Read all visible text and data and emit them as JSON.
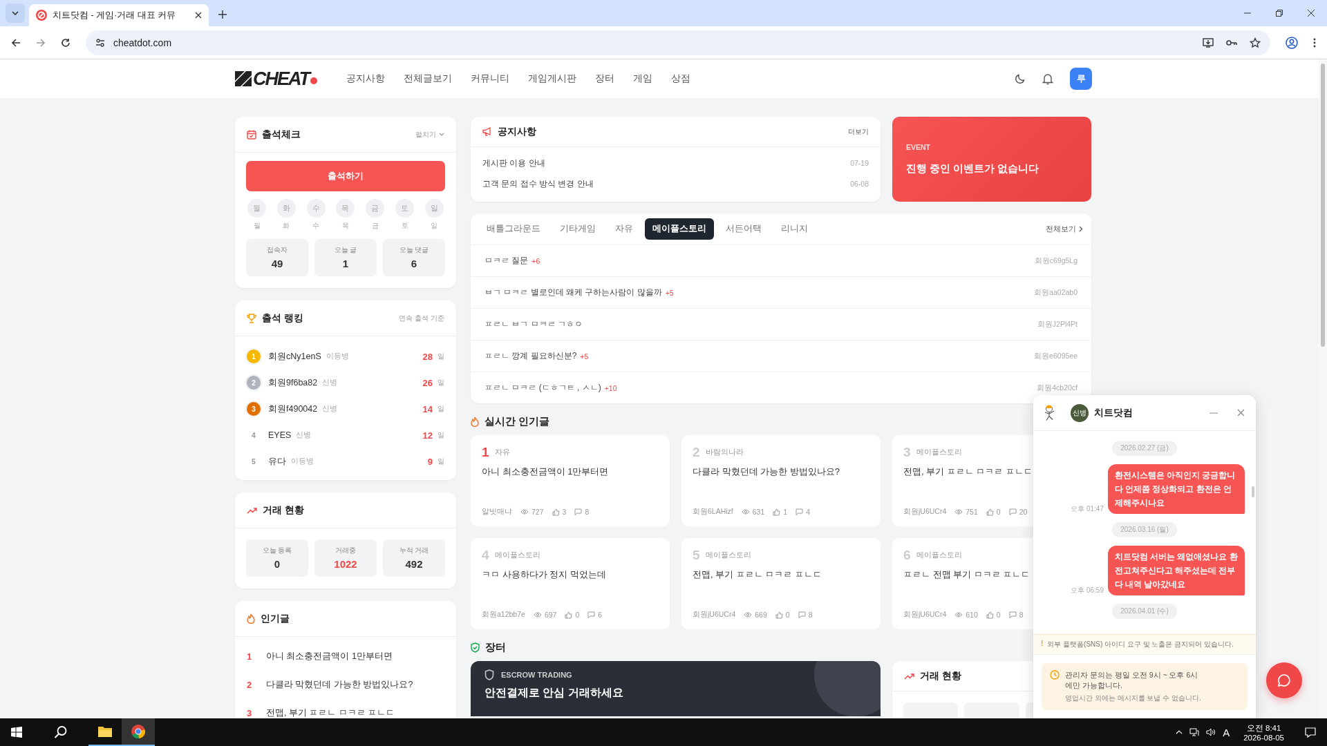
{
  "browser": {
    "tab_title": "치트닷컴 - 게임·거래 대표 커뮤",
    "url": "cheatdot.com"
  },
  "header": {
    "logo": "CHEAT",
    "nav": [
      "공지사항",
      "전체글보기",
      "커뮤니티",
      "게임게시판",
      "장터",
      "게임",
      "상점"
    ],
    "avatar": "루"
  },
  "attendance": {
    "title": "출석체크",
    "toggle": "펼치기",
    "button": "출석하기",
    "days": [
      {
        "circle": "월",
        "label": "월",
        "checked": false
      },
      {
        "circle": "화",
        "label": "화",
        "checked": false
      },
      {
        "circle": "수",
        "label": "수",
        "checked": false
      },
      {
        "circle": "목",
        "label": "목",
        "checked": false
      },
      {
        "circle": "금",
        "label": "금",
        "checked": false
      },
      {
        "circle": "토",
        "label": "토",
        "checked": false
      },
      {
        "circle": "일",
        "label": "일",
        "checked": false
      }
    ],
    "stats": [
      {
        "label": "접속자",
        "value": "49"
      },
      {
        "label": "오늘 글",
        "value": "1"
      },
      {
        "label": "오늘 댓글",
        "value": "6"
      }
    ]
  },
  "ranking": {
    "title": "출석 랭킹",
    "note": "연속 출석 기준",
    "items": [
      {
        "kind": "medal",
        "color": "#f5b800",
        "rank": "1",
        "name": "회원cNy1enS",
        "grade": "이등병",
        "days": "28",
        "unit": "일"
      },
      {
        "kind": "medal",
        "color": "#aeb4bd",
        "rank": "2",
        "name": "회원9f6ba82",
        "grade": "신병",
        "days": "26",
        "unit": "일"
      },
      {
        "kind": "medal",
        "color": "#e07000",
        "rank": "3",
        "name": "회원f490042",
        "grade": "신병",
        "days": "14",
        "unit": "일"
      },
      {
        "kind": "plain",
        "rank": "4",
        "name": "EYES",
        "grade": "신병",
        "days": "12",
        "unit": "일"
      },
      {
        "kind": "plain",
        "rank": "5",
        "name": "유다",
        "grade": "이등병",
        "days": "9",
        "unit": "일"
      }
    ]
  },
  "trade": {
    "title": "거래 현황",
    "stats": [
      {
        "label": "오늘 등록",
        "value": "0",
        "highlight": false
      },
      {
        "label": "거래중",
        "value": "1022",
        "highlight": true
      },
      {
        "label": "누적 거래",
        "value": "492",
        "highlight": false
      }
    ]
  },
  "popular": {
    "title": "인기글",
    "items": [
      {
        "rank": "1",
        "title": "아니 최소충전금액이 1만부터면"
      },
      {
        "rank": "2",
        "title": "다클라 막혔던데 가능한 방법있나요?"
      },
      {
        "rank": "3",
        "title": "전맵, 부기 ㅍㄹㄴ ㅁㅋㄹ ㅍㄴㄷ"
      }
    ]
  },
  "notice": {
    "title": "공지사항",
    "more": "더보기",
    "items": [
      {
        "title": "게시판 이용 안내",
        "date": "07-19"
      },
      {
        "title": "고객 문의 접수 방식 변경 안내",
        "date": "06-08"
      }
    ]
  },
  "event": {
    "label": "EVENT",
    "text": "진행 중인 이벤트가 없습니다"
  },
  "board": {
    "tabs": [
      {
        "label": "배틀그라운드",
        "selected": false
      },
      {
        "label": "기타게임",
        "selected": false
      },
      {
        "label": "자유",
        "selected": false
      },
      {
        "label": "메이플스토리",
        "selected": true
      },
      {
        "label": "서든어택",
        "selected": false
      },
      {
        "label": "리니지",
        "selected": false
      }
    ],
    "more": "전체보기",
    "posts": [
      {
        "title": "ㅁㅋㄹ 질문",
        "comments": "+6",
        "author": "회원c69g5Lg"
      },
      {
        "title": "ㅂㄱ ㅁㅋㄹ 별로인데 왜케 구하는사람이 많을까",
        "comments": "+5",
        "author": "회원aa02ab0"
      },
      {
        "title": "ㅍㄹㄴ ㅂㄱ ㅁㅋㄹ ㄱㅎㅇ",
        "author": "회원J2Pl4Pt"
      },
      {
        "title": "ㅍㄹㄴ 깡계 필요하신분?",
        "comments": "+5",
        "author": "회원e6095ee"
      },
      {
        "title": "ㅍㄹㄴ ㅁㅋㄹ (ㄷㅎㄱㅌ , ㅅㄴ)",
        "comments": "+10",
        "author": "회원4cb20cf"
      }
    ]
  },
  "realtime": {
    "title": "실시간 인기글",
    "cards": [
      {
        "rank": "1",
        "hot": true,
        "board": "자유",
        "title": "아니 최소충전금액이 1만부터면",
        "author": "알빗매냐",
        "views": "727",
        "likes": "3",
        "comments": "8"
      },
      {
        "rank": "2",
        "hot": false,
        "board": "바람의나라",
        "title": "다클라 막혔던데 가능한 방법있나요?",
        "author": "회원6LAHizf",
        "views": "631",
        "likes": "1",
        "comments": "4"
      },
      {
        "rank": "3",
        "hot": false,
        "board": "메이플스토리",
        "title": "전맵, 부기 ㅍㄹㄴ ㅁㅋㄹ ㅍㄴㄷ",
        "author": "회원jU6UCr4",
        "views": "751",
        "likes": "0",
        "comments": "20"
      },
      {
        "rank": "4",
        "hot": false,
        "board": "메이플스토리",
        "title": "ㅋㅁ 사용하다가 정지 먹었는데",
        "author": "회원a12bb7e",
        "views": "697",
        "likes": "0",
        "comments": "6"
      },
      {
        "rank": "5",
        "hot": false,
        "board": "메이플스토리",
        "title": "전맵, 부기 ㅍㄹㄴ ㅁㅋㄹ ㅍㄴㄷ",
        "author": "회원jU6UCr4",
        "views": "669",
        "likes": "0",
        "comments": "8"
      },
      {
        "rank": "6",
        "hot": false,
        "board": "메이플스토리",
        "title": "ㅍㄹㄴ 전맵 부기 ㅁㅋㄹ ㅍㄴㄷ",
        "author": "회원jU6UCr4",
        "views": "610",
        "likes": "0",
        "comments": "8"
      }
    ]
  },
  "market": {
    "title": "장터",
    "escrow_label": "ESCROW TRADING",
    "escrow_headline": "안전결제로 안심 거래하세요",
    "trade_title": "거래 현황"
  },
  "chat": {
    "title": "치트닷컴",
    "badge": "신병",
    "messages": [
      {
        "kind": "date",
        "text": "2026.02.27 (금)"
      },
      {
        "kind": "out",
        "text": "환전시스템은 아직인지 궁금합니다 언제쯤 정상화되고 환전은 언제해주시나요",
        "time": "오후 01:47"
      },
      {
        "kind": "date",
        "text": "2026.03.16 (월)"
      },
      {
        "kind": "out",
        "text": "치트닷컴 서버는 왜없애셨나요 환전고쳐주신다고 해주셨는데 전부다 내역 날아갔네요",
        "time": "오후 06:59"
      },
      {
        "kind": "date",
        "text": "2026.04.01 (수)"
      }
    ],
    "warning_mark": "!",
    "warning": "외부 플랫폼(SNS) 아이디 요구 및 노출은 금지되어 있습니다.",
    "hours": "관리자 문의는 평일 오전 9시 ~ 오후 6시에만 가능합니다.",
    "hours_note": "영업시간 외에는 메시지를 보낼 수 없습니다."
  },
  "taskbar": {
    "ime": "A",
    "time": "오전 8:41",
    "date": "2026-08-05"
  }
}
